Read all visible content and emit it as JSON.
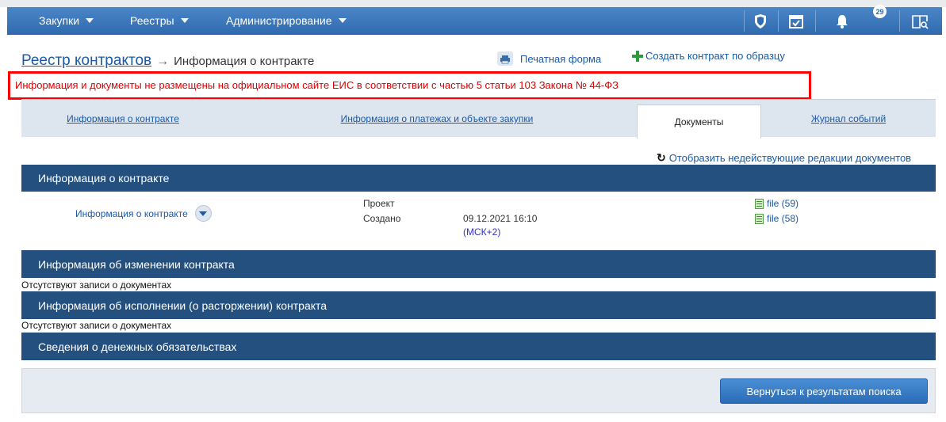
{
  "nav": {
    "items": [
      {
        "label": "Закупки"
      },
      {
        "label": "Реестры"
      },
      {
        "label": "Администрирование"
      }
    ],
    "notification_count": "29"
  },
  "breadcrumb": {
    "root": "Реестр контрактов",
    "arrow": "→",
    "current": "Информация о контракте"
  },
  "actions": {
    "print_label": "Печатная форма",
    "create_label": "Создать контракт по образцу"
  },
  "warning": "Информация и документы не размещены на официальном сайте ЕИС в соответствии с частью 5 статьи 103 Закона № 44-ФЗ",
  "tabs": [
    {
      "label": "Информация о контракте"
    },
    {
      "label": "Информация о платежах и объекте закупки"
    },
    {
      "label": "Документы"
    },
    {
      "label": "Журнал событий"
    }
  ],
  "show_inactive": "Отобразить недействующие редакции документов",
  "sections": {
    "contract_info": "Информация о контракте",
    "changes": "Информация об изменении контракта",
    "execution": "Информация об исполнении (о расторжении) контракта",
    "obligations": "Сведения о денежных обязательствах"
  },
  "document": {
    "name": "Информация о контракте",
    "status": "Проект",
    "created_label": "Создано",
    "created_date": "09.12.2021 16:10",
    "timezone": "(МСК+2)",
    "files": [
      {
        "label": "file (59)"
      },
      {
        "label": "file (58)"
      }
    ]
  },
  "no_docs": "Отсутствуют записи о документах",
  "back_button": "Вернуться к результатам поиска"
}
